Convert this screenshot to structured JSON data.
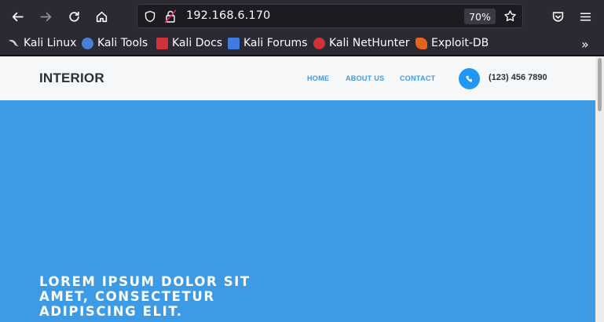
{
  "browser": {
    "url": "192.168.6.170",
    "zoom": "70%",
    "bookmarks": [
      {
        "label": "Kali Linux",
        "icon": "kali-dragon-icon",
        "color": "#bbbbbb"
      },
      {
        "label": "Kali Tools",
        "icon": "kali-tools-icon",
        "color": "#4a7fd9"
      },
      {
        "label": "Kali Docs",
        "icon": "kali-docs-icon",
        "color": "#d0323a"
      },
      {
        "label": "Kali Forums",
        "icon": "kali-forums-icon",
        "color": "#3f7be0"
      },
      {
        "label": "Kali NetHunter",
        "icon": "kali-nethunter-icon",
        "color": "#d0323a"
      },
      {
        "label": "Exploit-DB",
        "icon": "exploit-db-icon",
        "color": "#e6631e"
      }
    ]
  },
  "site": {
    "brand": "INTERIOR",
    "nav": [
      "HOME",
      "ABOUT US",
      "CONTACT"
    ],
    "phone": "(123) 456 7890",
    "hero_title": "LOREM IPSUM DOLOR SIT AMET, CONSECTETUR ADIPISCING ELIT.",
    "accent_color": "#3d9be6"
  }
}
